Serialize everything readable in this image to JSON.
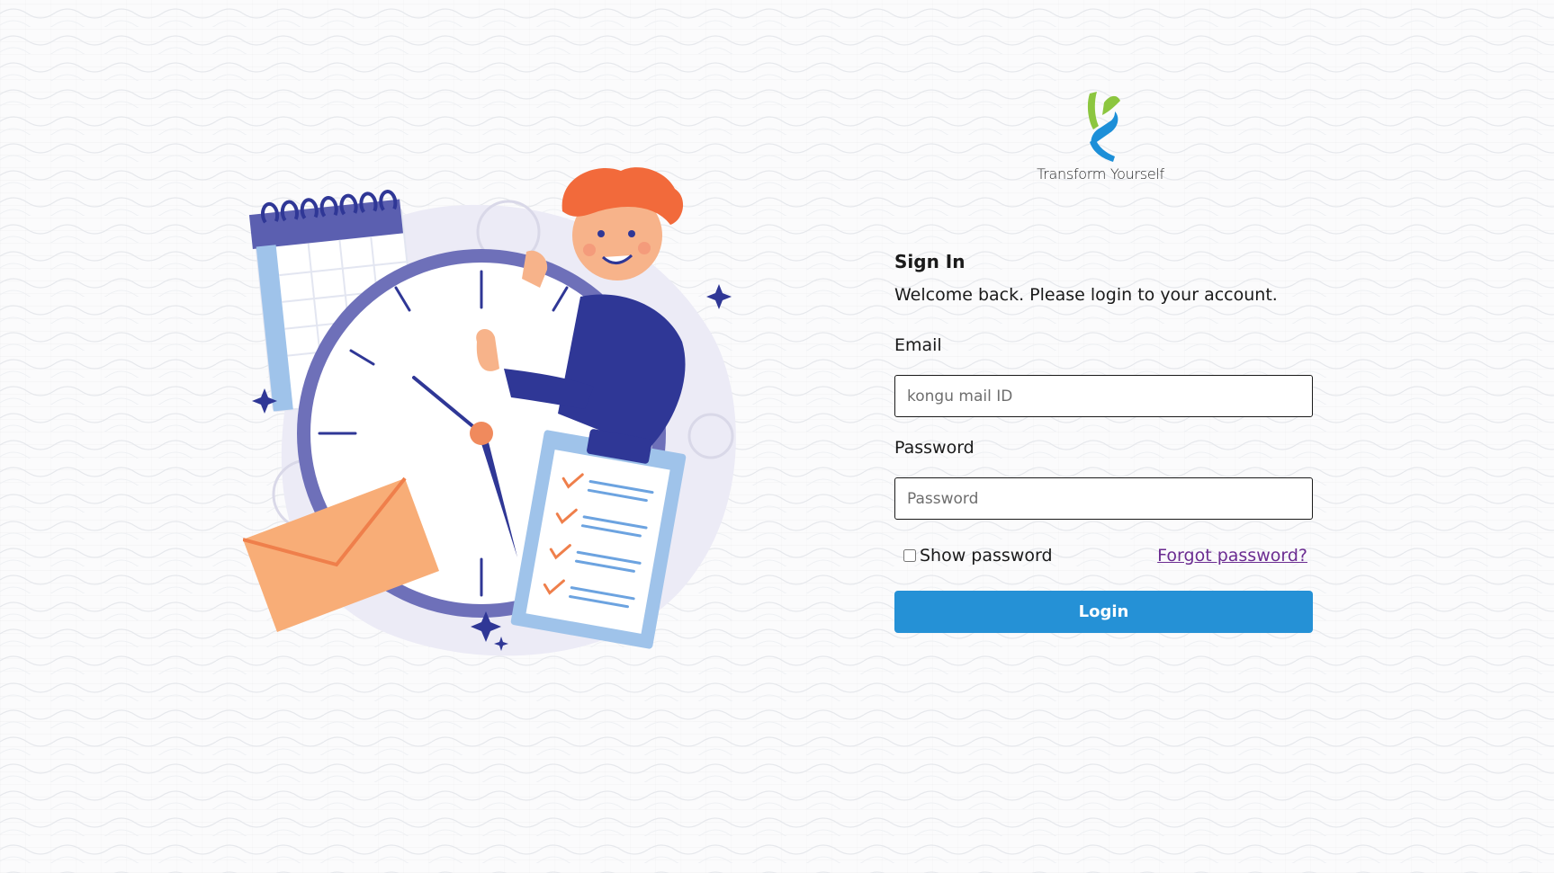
{
  "brand": {
    "tagline": "Transform Yourself",
    "colors": {
      "green": "#8cc63f",
      "blue": "#1d8fd8"
    }
  },
  "signin": {
    "title": "Sign In",
    "welcome": "Welcome back. Please login to your account."
  },
  "email": {
    "label": "Email",
    "placeholder": "kongu mail ID",
    "value": ""
  },
  "password": {
    "label": "Password",
    "placeholder": "Password",
    "value": ""
  },
  "options": {
    "show_password_label": "Show password",
    "show_password_checked": false,
    "forgot_label": "Forgot password?"
  },
  "login": {
    "label": "Login"
  },
  "illustration": {
    "icons": [
      "calendar-icon",
      "clock-icon",
      "person-icon",
      "envelope-icon",
      "clipboard-checklist-icon",
      "sparkle-icon",
      "gear-icon"
    ]
  },
  "theme": {
    "accent": "#2591d6",
    "link": "#6b2c91",
    "illustration_navy": "#2f3796",
    "illustration_orange": "#f08a5d"
  }
}
